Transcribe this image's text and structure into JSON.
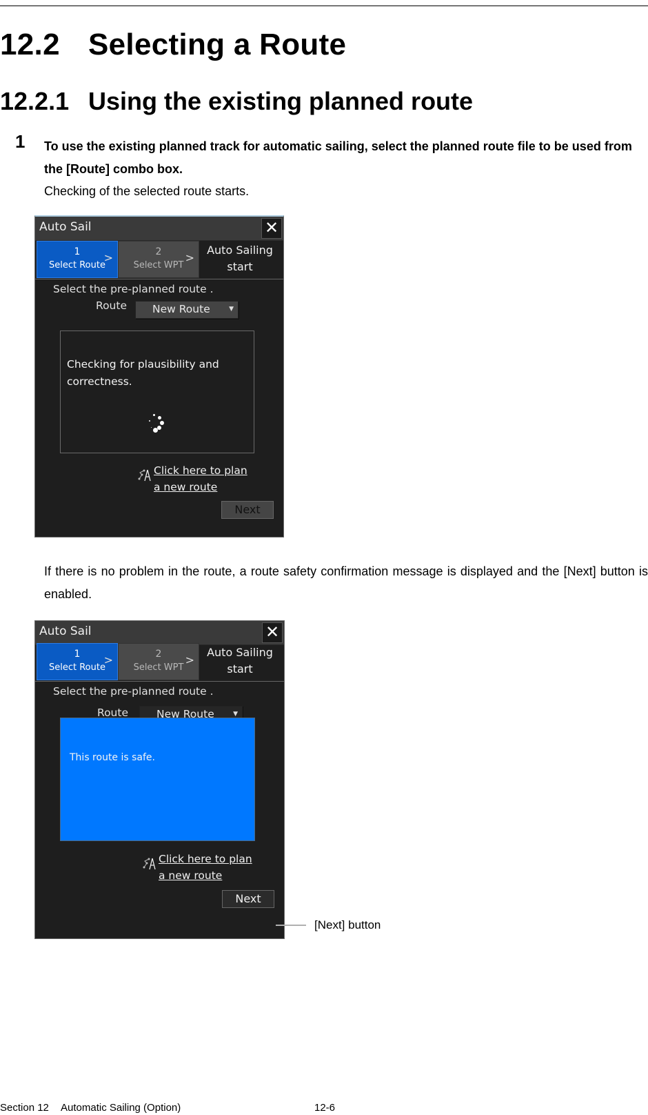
{
  "heading_section": {
    "number": "12.2",
    "title": "Selecting a Route"
  },
  "heading_subsection": {
    "number": "12.2.1",
    "title": "Using the existing planned route"
  },
  "step": {
    "number": "1",
    "instruction": "To use the existing planned track for automatic sailing, select the planned route file to be used from the [Route] combo box.",
    "note": "Checking of the selected route starts."
  },
  "paragraph_after_first": "If there is no problem in the route, a route safety confirmation message is displayed and the [Next] button is enabled.",
  "dialog_checking": {
    "title": "Auto Sail",
    "close_icon": "close-x-icon",
    "steps": [
      {
        "number": "1",
        "label": "Select Route",
        "state": "active"
      },
      {
        "number": "2",
        "label": "Select WPT",
        "state": "inactive"
      },
      {
        "label_line1": "Auto Sailing",
        "label_line2": "start"
      }
    ],
    "prompt": "Select the pre-planned route .",
    "route_label": "Route",
    "route_value": "New Route",
    "message": "Checking for plausibility and correctness.",
    "spinner_icon": "loading-spinner-icon",
    "plan_link_line1": "Click here to plan",
    "plan_link_line2": "a new route",
    "plan_icon": "route-plan-compass-icon",
    "next_label": "Next",
    "next_enabled": false
  },
  "dialog_safe": {
    "title": "Auto Sail",
    "close_icon": "close-x-icon",
    "steps": [
      {
        "number": "1",
        "label": "Select Route",
        "state": "active"
      },
      {
        "number": "2",
        "label": "Select WPT",
        "state": "inactive"
      },
      {
        "label_line1": "Auto Sailing",
        "label_line2": "start"
      }
    ],
    "prompt": "Select the pre-planned route .",
    "route_label": "Route",
    "route_value": "New Route",
    "message": "This route is safe.",
    "message_bg_color": "#0078ff",
    "plan_link_line1": "Click here to plan",
    "plan_link_line2": "a new route",
    "plan_icon": "route-plan-compass-icon",
    "next_label": "Next",
    "next_enabled": true
  },
  "callout": {
    "text": "[Next] button"
  },
  "footer": {
    "section": "Section 12",
    "chapter": "Automatic Sailing (Option)",
    "page": "12-6"
  },
  "colors": {
    "accent_blue": "#0a5bc4",
    "safe_blue": "#0078ff",
    "dialog_bg": "#1e1e1e"
  }
}
